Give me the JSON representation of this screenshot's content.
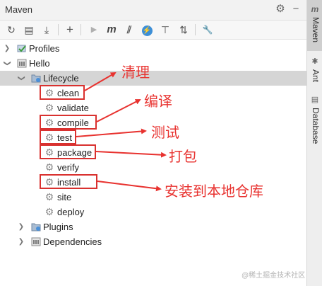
{
  "window": {
    "title": "Maven"
  },
  "toolbar": {
    "reload_icon": "↻",
    "add_project_icon": "▤",
    "download_icon": "⤓",
    "add_icon": "+",
    "run_icon": "▶",
    "maven_goal_icon": "m",
    "skip_tests_icon": "⫽",
    "offline_icon": "⚡",
    "show_deps_icon": "⊤",
    "collapse_icon": "⇅",
    "settings_icon": "🔧"
  },
  "tree": {
    "profiles": "Profiles",
    "project": "Hello",
    "lifecycle": "Lifecycle",
    "goals": [
      "clean",
      "validate",
      "compile",
      "test",
      "package",
      "verify",
      "install",
      "site",
      "deploy"
    ],
    "plugins": "Plugins",
    "dependencies": "Dependencies"
  },
  "annotations": {
    "clean": "清理",
    "compile": "编译",
    "test": "测试",
    "package": "打包",
    "install": "安装到本地仓库",
    "color": "#e8322f"
  },
  "sidebar": {
    "maven": "Maven",
    "ant": "Ant",
    "database": "Database"
  },
  "watermark": "@稀土掘金技术社区"
}
